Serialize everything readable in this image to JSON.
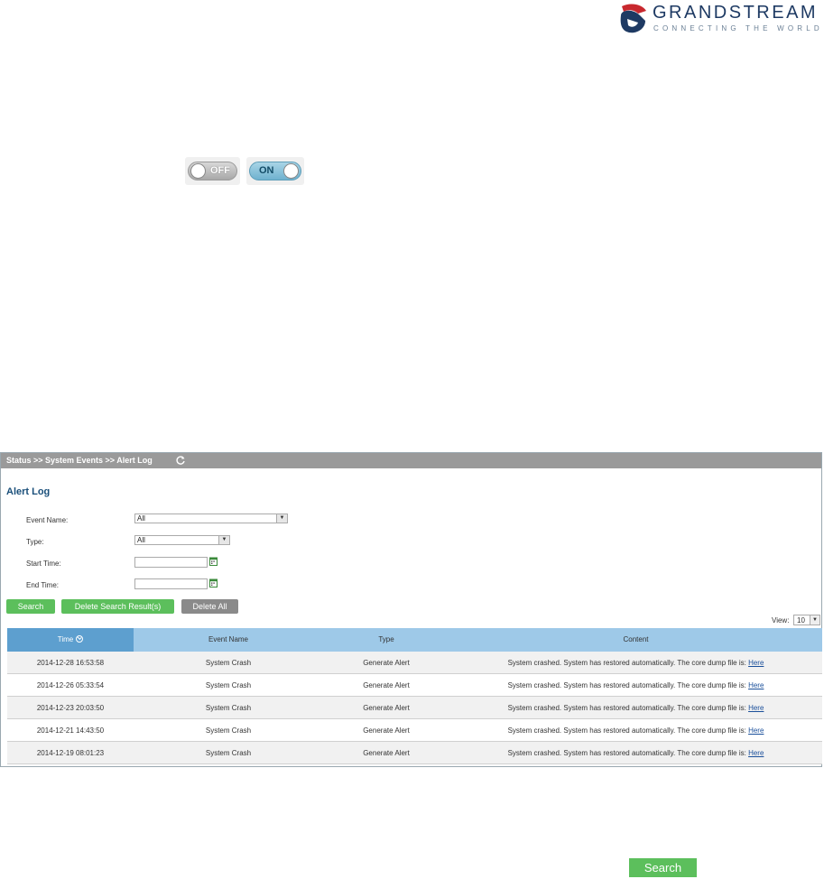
{
  "logo": {
    "wordmark": "GRANDSTREAM",
    "tagline": "CONNECTING THE WORLD",
    "colors": {
      "mark_red": "#c8282e",
      "mark_blue": "#1e3a63"
    }
  },
  "toggles": [
    {
      "label": "OFF",
      "state": "off"
    },
    {
      "label": "ON",
      "state": "on"
    }
  ],
  "panel": {
    "breadcrumb": "Status >> System Events >> Alert Log",
    "title": "Alert Log",
    "filters": {
      "event_name": {
        "label": "Event Name:",
        "value": "All"
      },
      "type": {
        "label": "Type:",
        "value": "All"
      },
      "start_time": {
        "label": "Start Time:",
        "value": ""
      },
      "end_time": {
        "label": "End Time:",
        "value": ""
      }
    },
    "buttons": {
      "search": "Search",
      "delete_search_result": "Delete Search Result(s)",
      "delete_all": "Delete All"
    },
    "view": {
      "label": "View:",
      "value": "10"
    },
    "table": {
      "columns": [
        "Time",
        "Event Name",
        "Type",
        "Content"
      ],
      "rows": [
        {
          "time": "2014-12-28 16:53:58",
          "event": "System Crash",
          "type": "Generate Alert",
          "content": "System crashed. System has restored automatically. The core dump file is:",
          "link": "Here"
        },
        {
          "time": "2014-12-26 05:33:54",
          "event": "System Crash",
          "type": "Generate Alert",
          "content": "System crashed. System has restored automatically. The core dump file is:",
          "link": "Here"
        },
        {
          "time": "2014-12-23 20:03:50",
          "event": "System Crash",
          "type": "Generate Alert",
          "content": "System crashed. System has restored automatically. The core dump file is:",
          "link": "Here"
        },
        {
          "time": "2014-12-21 14:43:50",
          "event": "System Crash",
          "type": "Generate Alert",
          "content": "System crashed. System has restored automatically. The core dump file is:",
          "link": "Here"
        },
        {
          "time": "2014-12-19 08:01:23",
          "event": "System Crash",
          "type": "Generate Alert",
          "content": "System crashed. System has restored automatically. The core dump file is:",
          "link": "Here"
        }
      ]
    }
  },
  "bottom_button": "Search",
  "colors": {
    "accent_green": "#5cbf5c",
    "header_blue": "#9ec9e8",
    "sorted_col_blue": "#5d9fcf",
    "title_blue": "#1a4f7a"
  }
}
